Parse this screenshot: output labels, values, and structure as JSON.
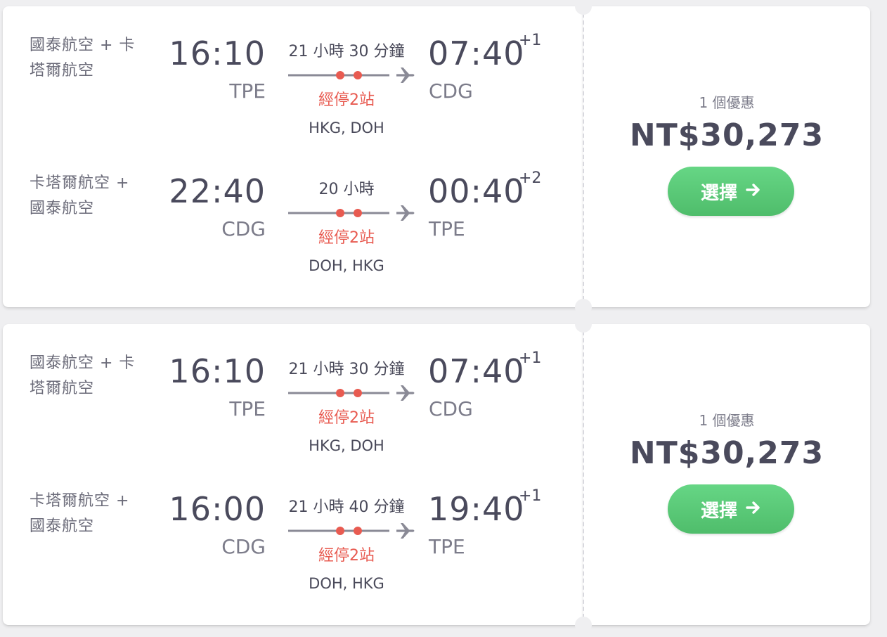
{
  "results": [
    {
      "legs": [
        {
          "airlines_line1": "國泰航空 + 卡",
          "airlines_line2": "塔爾航空",
          "departure_time": "16:10",
          "departure_airport": "TPE",
          "duration": "21 小時 30 分鐘",
          "stops_label": "經停2站",
          "stopover_airports": "HKG, DOH",
          "arrival_time": "07:40",
          "arrival_day_offset": "+1",
          "arrival_airport": "CDG"
        },
        {
          "airlines_line1": "卡塔爾航空 +",
          "airlines_line2": "國泰航空",
          "departure_time": "22:40",
          "departure_airport": "CDG",
          "duration": "20 小時",
          "stops_label": "經停2站",
          "stopover_airports": "DOH, HKG",
          "arrival_time": "00:40",
          "arrival_day_offset": "+2",
          "arrival_airport": "TPE"
        }
      ],
      "deals_label": "1 個優惠",
      "price": "NT$30,273",
      "select_label": "選擇"
    },
    {
      "legs": [
        {
          "airlines_line1": "國泰航空 + 卡",
          "airlines_line2": "塔爾航空",
          "departure_time": "16:10",
          "departure_airport": "TPE",
          "duration": "21 小時 30 分鐘",
          "stops_label": "經停2站",
          "stopover_airports": "HKG, DOH",
          "arrival_time": "07:40",
          "arrival_day_offset": "+1",
          "arrival_airport": "CDG"
        },
        {
          "airlines_line1": "卡塔爾航空 +",
          "airlines_line2": "國泰航空",
          "departure_time": "16:00",
          "departure_airport": "CDG",
          "duration": "21 小時 40 分鐘",
          "stops_label": "經停2站",
          "stopover_airports": "DOH, HKG",
          "arrival_time": "19:40",
          "arrival_day_offset": "+1",
          "arrival_airport": "TPE"
        }
      ],
      "deals_label": "1 個優惠",
      "price": "NT$30,273",
      "select_label": "選擇"
    }
  ],
  "icons": {
    "route_plane": "airplane-icon",
    "stop_dot": "stop-dot-icon",
    "select_arrow": "arrow-right-icon"
  },
  "colors": {
    "stop_red": "#e85b51",
    "button_green": "#5ccd7a",
    "text_dark": "#4a4a5c",
    "text_muted": "#7c7c8a",
    "route_line": "#8a8a96"
  }
}
